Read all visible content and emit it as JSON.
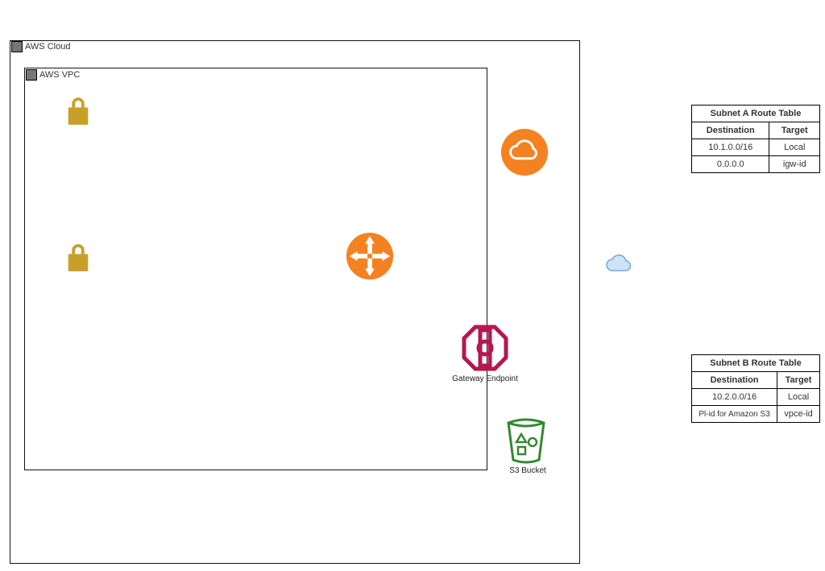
{
  "cloud_group": {
    "label": "AWS Cloud"
  },
  "vpc_group": {
    "label": "AWS VPC"
  },
  "gateway_endpoint": {
    "label": "Gateway Endpoint"
  },
  "s3_bucket": {
    "label": "S3 Bucket"
  },
  "route_table_a": {
    "title": "Subnet A Route Table",
    "header_dest": "Destination",
    "header_target": "Target",
    "rows": [
      {
        "dest": "10.1.0.0/16",
        "target": "Local"
      },
      {
        "dest": "0.0.0.0",
        "target": "igw-id"
      }
    ]
  },
  "route_table_b": {
    "title": "Subnet B Route Table",
    "header_dest": "Destination",
    "header_target": "Target",
    "rows": [
      {
        "dest": "10.2.0.0/16",
        "target": "Local"
      },
      {
        "dest": "Pl-id for Amazon S3",
        "target": "vpce-id"
      }
    ]
  },
  "colors": {
    "orange": "#f58220",
    "lock": "#c8a029",
    "magenta": "#b5174e",
    "bucket": "#338833",
    "cloud": "#6fa9e0"
  }
}
